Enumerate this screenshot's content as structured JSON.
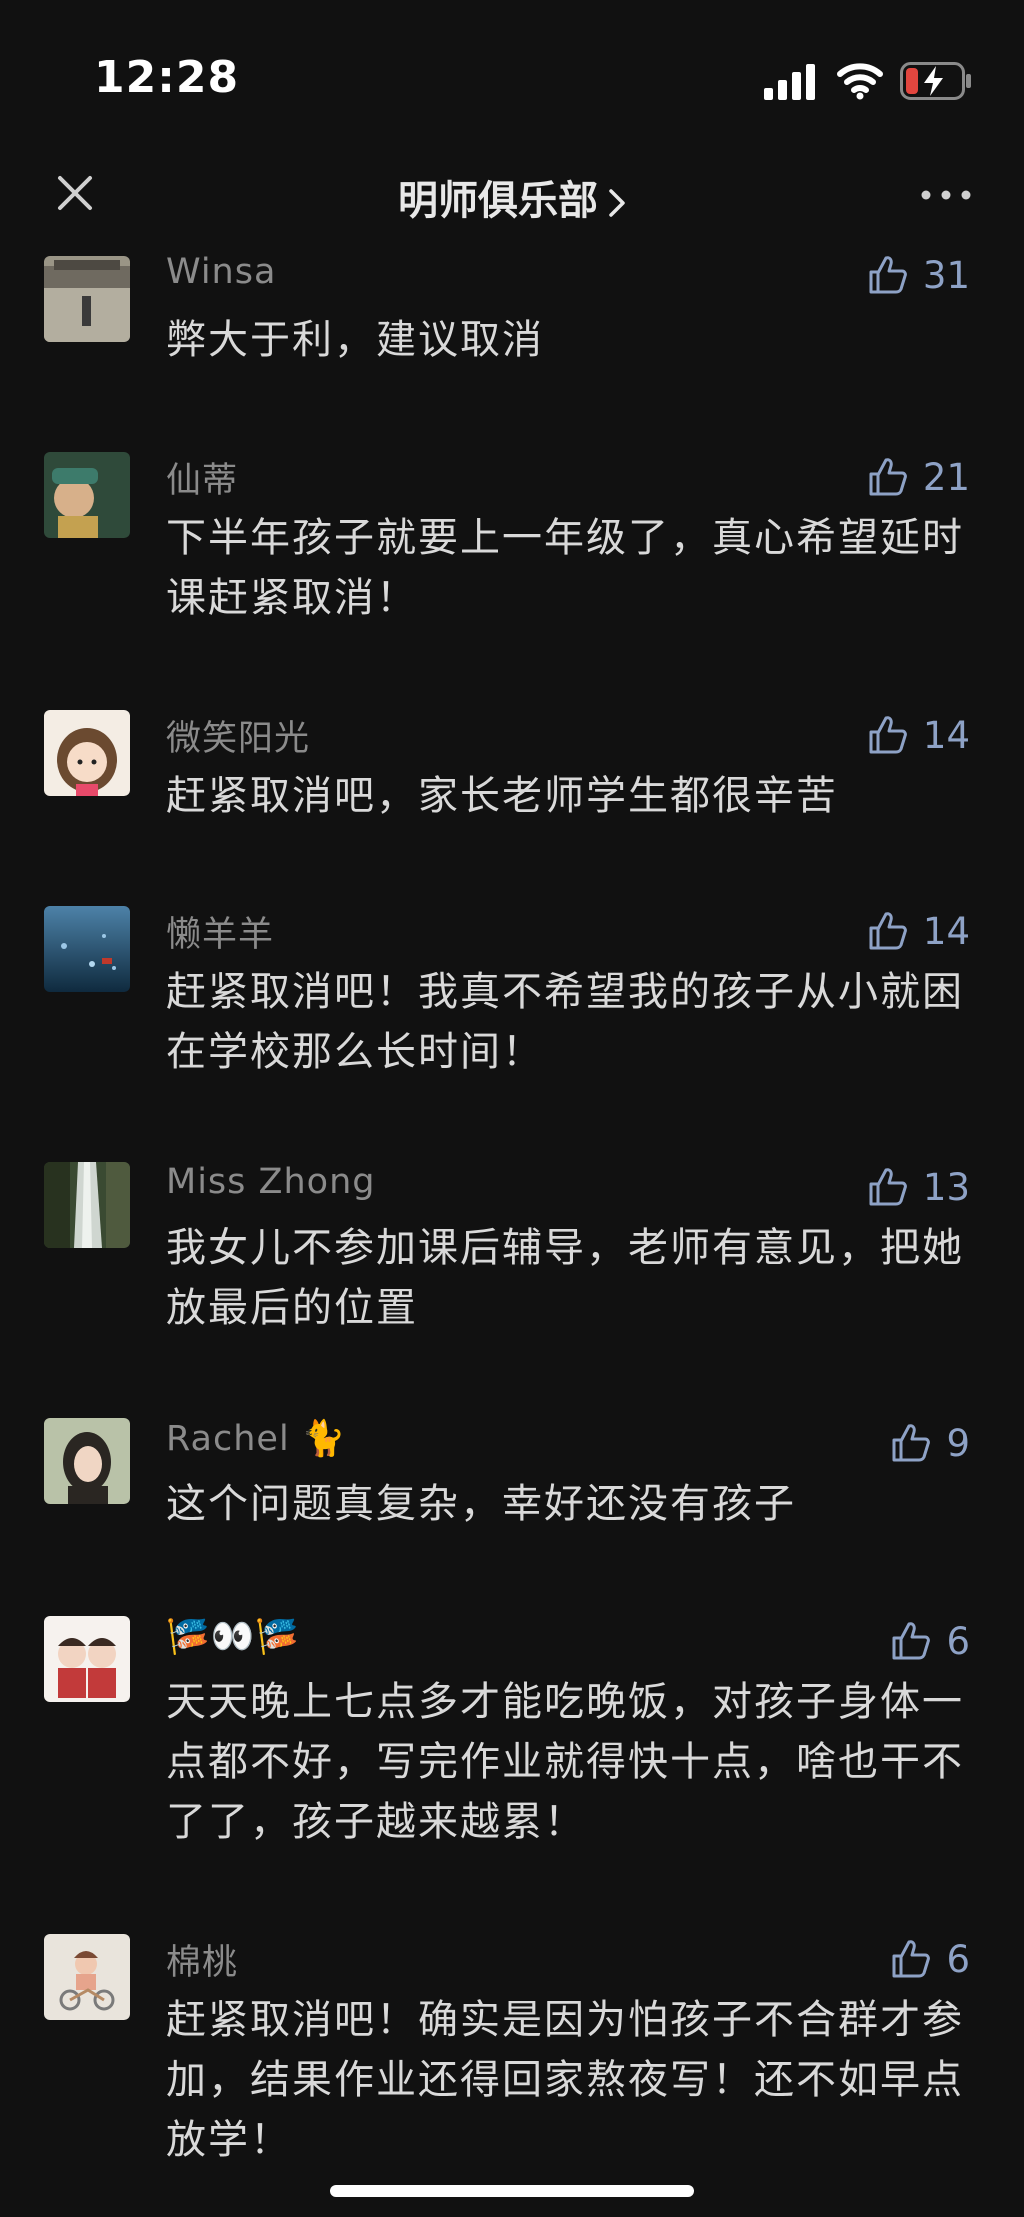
{
  "status": {
    "time": "12:28"
  },
  "nav": {
    "title": "明师俱乐部"
  },
  "comments": [
    {
      "author": "Winsa",
      "likes": "31",
      "text": "弊大于利，建议取消",
      "avatar_colors": [
        "#9a9586",
        "#5e5a52"
      ]
    },
    {
      "author": "仙蒂",
      "likes": "21",
      "text": "下半年孩子就要上一年级了，真心希望延时课赶紧取消！",
      "avatar_colors": [
        "#2f4a3a",
        "#c4a150"
      ]
    },
    {
      "author": "微笑阳光",
      "likes": "14",
      "text": "赶紧取消吧，家长老师学生都很辛苦",
      "avatar_colors": [
        "#f4ede4",
        "#6b4a30"
      ]
    },
    {
      "author": "懒羊羊",
      "likes": "14",
      "text": "赶紧取消吧！我真不希望我的孩子从小就困在学校那么长时间！",
      "avatar_colors": [
        "#2e5b7c",
        "#0f2a3e"
      ]
    },
    {
      "author": "Miss Zhong",
      "likes": "13",
      "text": "我女儿不参加课后辅导，老师有意见，把她放最后的位置",
      "avatar_colors": [
        "#3a4a32",
        "#cfd6d0"
      ]
    },
    {
      "author": "Rachel 🐈",
      "likes": "9",
      "text": "这个问题真复杂，幸好还没有孩子",
      "avatar_colors": [
        "#b9c2a8",
        "#2a2622"
      ]
    },
    {
      "author": "🎏👀🎏",
      "likes": "6",
      "text": "天天晚上七点多才能吃晚饭，对孩子身体一点都不好，写完作业就得快十点，啥也干不了了，孩子越来越累！",
      "avatar_colors": [
        "#f6f2ee",
        "#c23a3a"
      ]
    },
    {
      "author": "棉桃",
      "likes": "6",
      "text": "赶紧取消吧！确实是因为怕孩子不合群才参加，结果作业还得回家熬夜写！还不如早点放学！",
      "avatar_colors": [
        "#e9e4dc",
        "#b58a64"
      ]
    }
  ],
  "icons": {
    "close": "close-icon",
    "more": "more-dots-icon",
    "like": "thumbs-up-icon",
    "chevron": "chevron-right-icon"
  },
  "colors": {
    "like_count": "#8ea2c6",
    "battery_low": "#e2463f"
  }
}
